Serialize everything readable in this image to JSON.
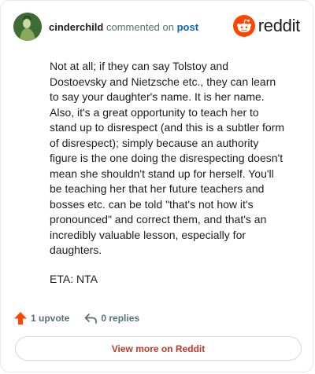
{
  "header": {
    "username": "cinderchild",
    "action_text": "commented on",
    "post_link": "post",
    "brand": "reddit"
  },
  "comment": {
    "paragraphs": [
      "Not at all; if they can say Tolstoy and Dostoevsky and Nietzsche etc., they can learn to say your daughter's name. It is her name. Also, it's a great opportunity to teach her to stand up to disrespect (and this is a subtler form of disrespect); simply because an authority figure is the one doing the disrespecting doesn't mean she shouldn't stand up for herself. You'll be teaching her that her future teachers and bosses etc. can be told \"that's not how it's pronounced\" and correct them, and that's an incredibly valuable lesson, especially for daughters.",
      "ETA: NTA"
    ]
  },
  "actions": {
    "upvote_label": "1 upvote",
    "reply_label": "0 replies"
  },
  "footer": {
    "view_more_label": "View more on Reddit"
  },
  "colors": {
    "brand_orange": "#ff4500",
    "link_blue": "#0a66c2",
    "view_more_red": "#c0392b"
  },
  "icons": {
    "brand": "reddit-snoo-icon",
    "upvote": "upvote-arrow-icon",
    "reply": "reply-arrow-icon"
  }
}
